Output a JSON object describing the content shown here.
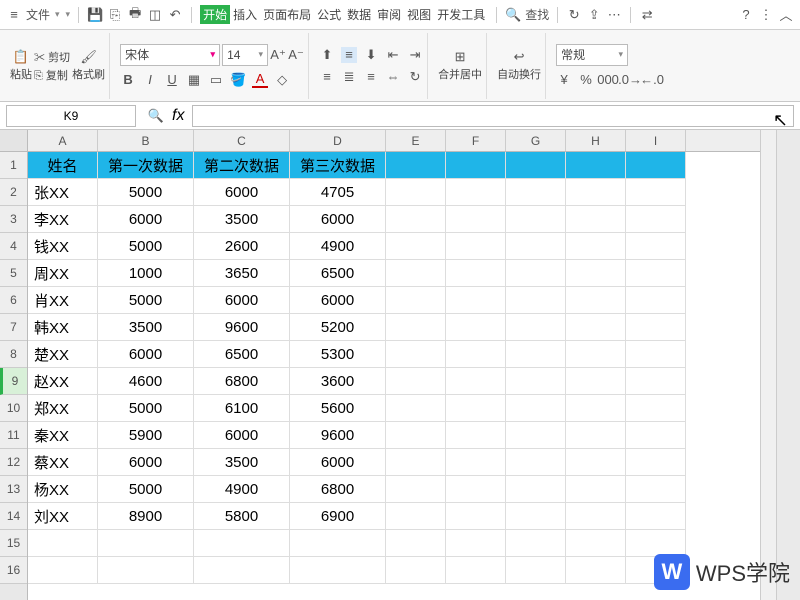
{
  "topbar": {
    "file": "文件",
    "search": "查找"
  },
  "tabs": {
    "start": "开始",
    "insert": "插入",
    "layout": "页面布局",
    "formula": "公式",
    "data": "数据",
    "review": "审阅",
    "view": "视图",
    "dev": "开发工具"
  },
  "ribbon": {
    "paste": "粘贴",
    "cut": "剪切",
    "copy": "复制",
    "formatpainter": "格式刷",
    "fontname": "宋体",
    "fontsize": "14",
    "merge": "合并居中",
    "wrap": "自动换行",
    "numfmt": "常规"
  },
  "cellref": "K9",
  "cols": [
    "A",
    "B",
    "C",
    "D",
    "E",
    "F",
    "G",
    "H",
    "I"
  ],
  "rows": [
    "1",
    "2",
    "3",
    "4",
    "5",
    "6",
    "7",
    "8",
    "9",
    "10",
    "11",
    "12",
    "13",
    "14",
    "15",
    "16"
  ],
  "header": {
    "a": "姓名",
    "b": "第一次数据",
    "c": "第二次数据",
    "d": "第三次数据"
  },
  "data": [
    {
      "a": "张XX",
      "b": "5000",
      "c": "6000",
      "d": "4705"
    },
    {
      "a": "李XX",
      "b": "6000",
      "c": "3500",
      "d": "6000"
    },
    {
      "a": "钱XX",
      "b": "5000",
      "c": "2600",
      "d": "4900"
    },
    {
      "a": "周XX",
      "b": "1000",
      "c": "3650",
      "d": "6500"
    },
    {
      "a": "肖XX",
      "b": "5000",
      "c": "6000",
      "d": "6000"
    },
    {
      "a": "韩XX",
      "b": "3500",
      "c": "9600",
      "d": "5200"
    },
    {
      "a": "楚XX",
      "b": "6000",
      "c": "6500",
      "d": "5300"
    },
    {
      "a": "赵XX",
      "b": "4600",
      "c": "6800",
      "d": "3600"
    },
    {
      "a": "郑XX",
      "b": "5000",
      "c": "6100",
      "d": "5600"
    },
    {
      "a": "秦XX",
      "b": "5900",
      "c": "6000",
      "d": "9600"
    },
    {
      "a": "蔡XX",
      "b": "6000",
      "c": "3500",
      "d": "6000"
    },
    {
      "a": "杨XX",
      "b": "5000",
      "c": "4900",
      "d": "6800"
    },
    {
      "a": "刘XX",
      "b": "8900",
      "c": "5800",
      "d": "6900"
    }
  ],
  "watermark": "WPS学院",
  "selectedRow": 9
}
